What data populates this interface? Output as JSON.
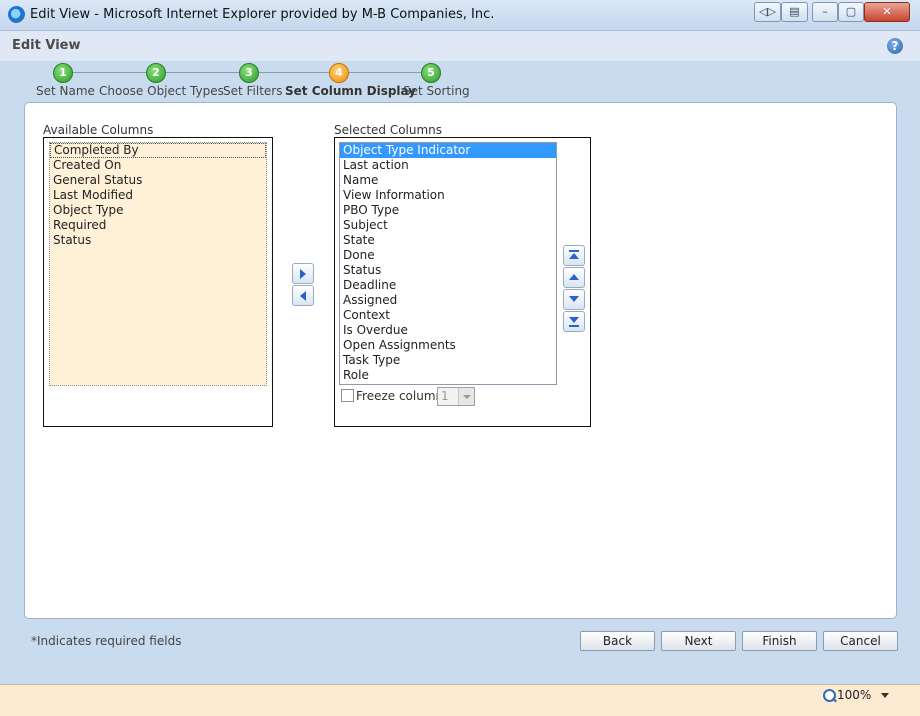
{
  "window": {
    "title": "Edit View - Microsoft Internet Explorer provided by M-B Companies, Inc.",
    "controls": [
      "back-forward",
      "page",
      "minimize",
      "maximize",
      "close"
    ]
  },
  "dialog": {
    "title": "Edit View"
  },
  "wizard": {
    "steps": [
      {
        "number": "1",
        "label": "Set Name",
        "state": "complete",
        "color": "#3aa335"
      },
      {
        "number": "2",
        "label": "Choose Object Types",
        "state": "complete",
        "color": "#3aa335"
      },
      {
        "number": "3",
        "label": "Set Filters",
        "state": "complete",
        "color": "#3aa335"
      },
      {
        "number": "4",
        "label": "Set Column Display",
        "state": "active",
        "color": "#f29a1a"
      },
      {
        "number": "5",
        "label": "Set Sorting",
        "state": "pending",
        "color": "#3aa335"
      }
    ]
  },
  "available": {
    "label": "Available Columns",
    "items": [
      "Completed By",
      "Created On",
      "General Status",
      "Last Modified",
      "Object Type",
      "Required",
      "Status"
    ],
    "focused_index": 0
  },
  "selected": {
    "label": "Selected Columns",
    "items": [
      "Object Type Indicator",
      "Last action",
      "Name",
      "View Information",
      "PBO Type",
      "Subject",
      "State",
      "Done",
      "Status",
      "Deadline",
      "Assigned",
      "Context",
      "Is Overdue",
      "Open Assignments",
      "Task Type",
      "Role"
    ],
    "selected_index": 0
  },
  "freeze": {
    "label": "Freeze column",
    "checked": false,
    "value": "1"
  },
  "footer": {
    "required_note": "*Indicates required fields",
    "back_label": "Back",
    "next_label": "Next",
    "finish_label": "Finish",
    "cancel_label": "Cancel"
  },
  "statusbar": {
    "zoom": "100%"
  }
}
